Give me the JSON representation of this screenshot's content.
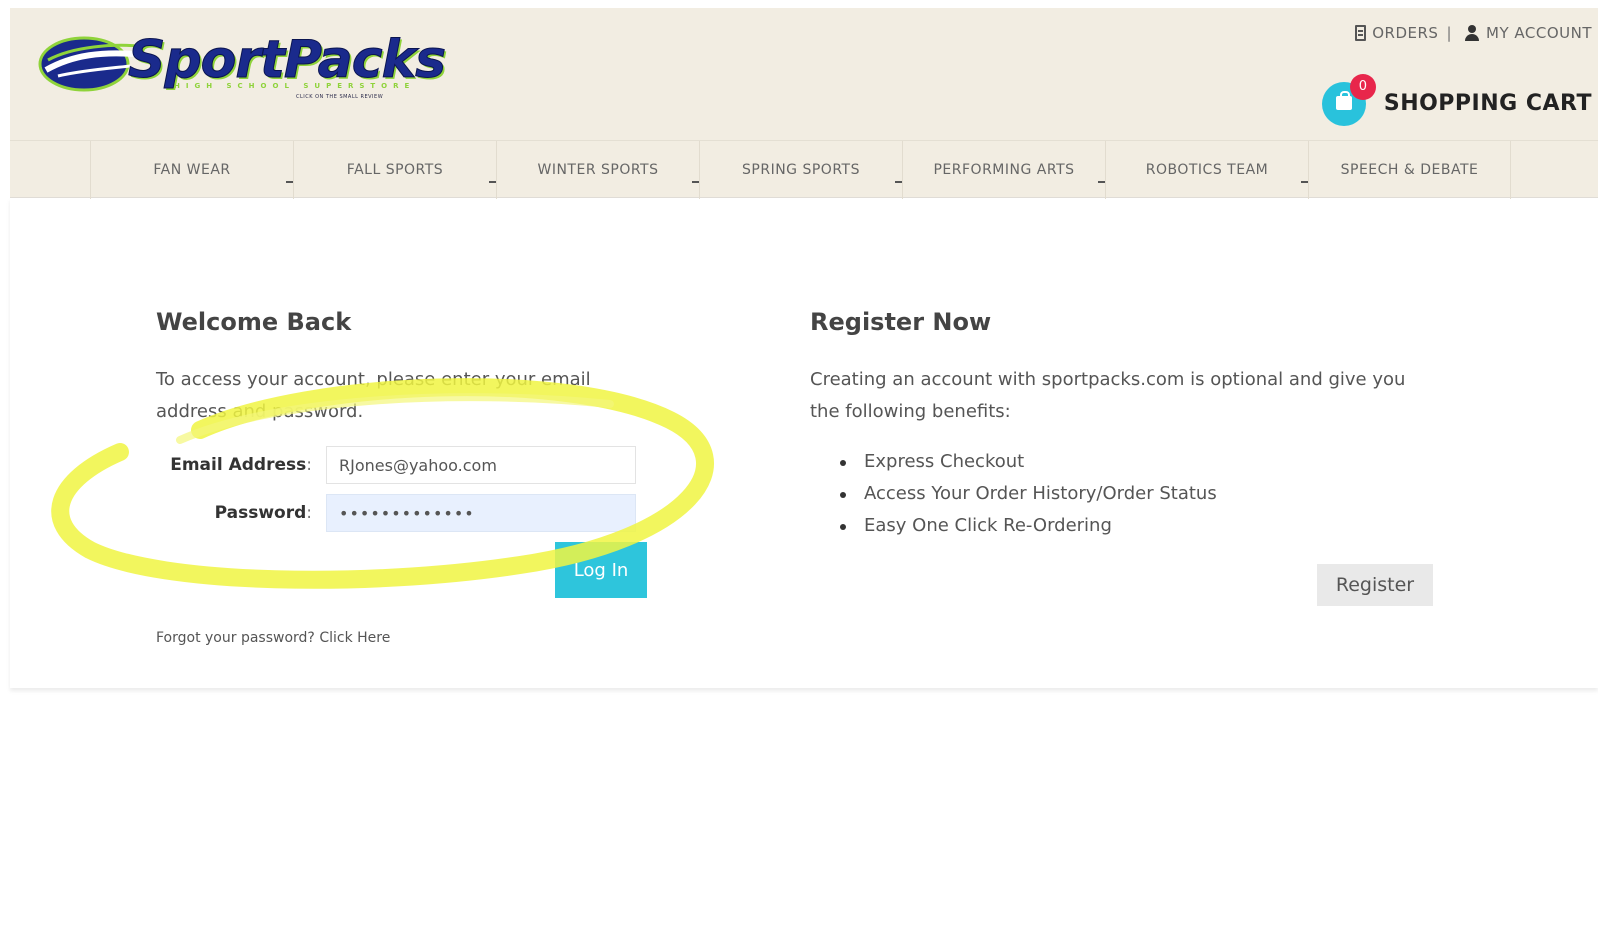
{
  "brand": {
    "name": "SportPacks",
    "tagline": "HIGH SCHOOL SUPERSTORE",
    "subtagline": "CLICK ON THE SMALL REVIEW",
    "colors": {
      "navy": "#1a2a8c",
      "lime": "#8fd33a"
    }
  },
  "top_links": {
    "orders_label": "ORDERS",
    "separator": "|",
    "account_label": "MY ACCOUNT"
  },
  "cart": {
    "count": "0",
    "label": "SHOPPING CART",
    "color": "#29c2dc",
    "badge_color": "#e8264b"
  },
  "nav": {
    "items": [
      "FAN WEAR",
      "FALL SPORTS",
      "WINTER SPORTS",
      "SPRING SPORTS",
      "PERFORMING ARTS",
      "ROBOTICS TEAM",
      "SPEECH & DEBATE"
    ]
  },
  "login": {
    "title": "Welcome Back",
    "intro": "To access your account, please enter your email address and password.",
    "email_label": "Email Address",
    "email_value": "RJones@yahoo.com",
    "password_label": "Password",
    "password_value": "•••••••••••••",
    "colon": ":",
    "button_label": "Log In",
    "forgot_text": "Forgot your password?",
    "forgot_link": "Click Here",
    "button_color": "#2ec5dc",
    "highlight_color": "#f0f542"
  },
  "register": {
    "title": "Register Now",
    "intro": "Creating an account with sportpacks.com is optional and give you the following benefits:",
    "benefits": [
      "Express Checkout",
      "Access Your Order History/Order Status",
      "Easy One Click Re-Ordering"
    ],
    "button_label": "Register"
  }
}
